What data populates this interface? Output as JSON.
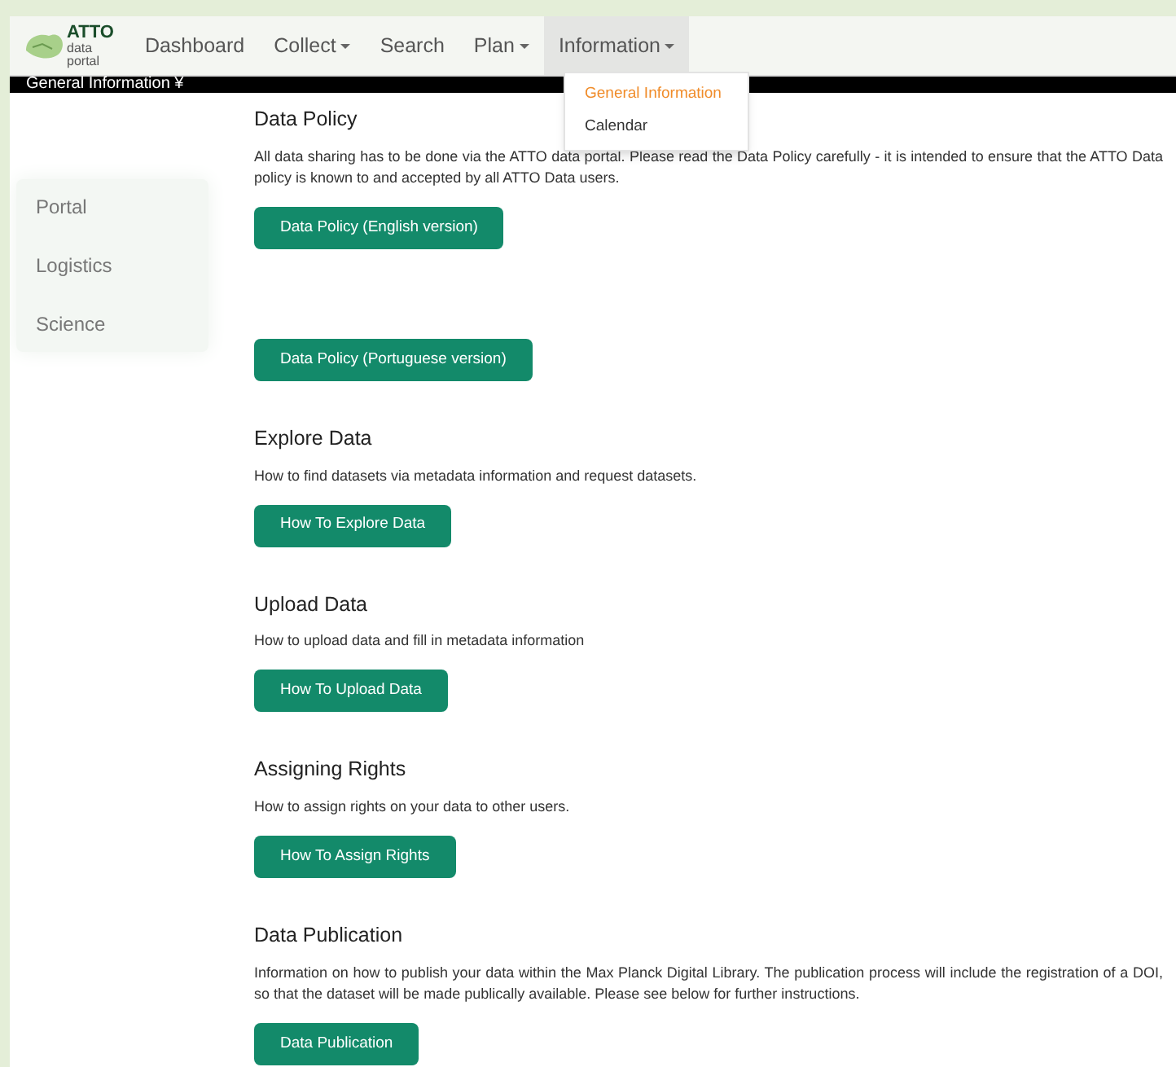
{
  "logo": {
    "lines": [
      "ATTO",
      "data",
      "portal"
    ]
  },
  "nav": [
    {
      "label": "Dashboard",
      "dropdown": false,
      "open": false
    },
    {
      "label": "Collect",
      "dropdown": true,
      "open": false
    },
    {
      "label": "Search",
      "dropdown": false,
      "open": false
    },
    {
      "label": "Plan",
      "dropdown": true,
      "open": false
    },
    {
      "label": "Information",
      "dropdown": true,
      "open": true
    }
  ],
  "menu": [
    {
      "label": "General Information",
      "selected": true
    },
    {
      "label": "Calendar",
      "selected": false
    }
  ],
  "subbar": {
    "label": "General Information ¥"
  },
  "sidebar": [
    "Portal",
    "Logistics",
    "Science"
  ],
  "sections": [
    {
      "title": "Data Policy",
      "text": "All data sharing has to be done via the ATTO data portal. Please read the Data Policy carefully - it is intended to ensure that the ATTO Data policy is known to and accepted by all ATTO Data users.",
      "buttons": [
        "Data Policy (English version)",
        "Data Policy (Portuguese version)"
      ]
    },
    {
      "title": "Explore Data",
      "text": "How to find datasets via metadata information and request datasets.",
      "buttons": [
        "How To Explore Data"
      ]
    },
    {
      "title": "Upload Data",
      "text": "How to upload data and fill in metadata information",
      "buttons": [
        "How To Upload Data"
      ]
    },
    {
      "title": "Assigning Rights",
      "text": "How to assign rights on your data to other users.",
      "buttons": [
        "How To Assign Rights"
      ]
    },
    {
      "title": "Data Publication",
      "text": "Information on how to publish your data within the Max Planck Digital Library. The publication process will include the registration of a DOI, so that the dataset will be made publically available. Please see below for further instructions.",
      "buttons": [
        "Data Publication"
      ]
    }
  ]
}
